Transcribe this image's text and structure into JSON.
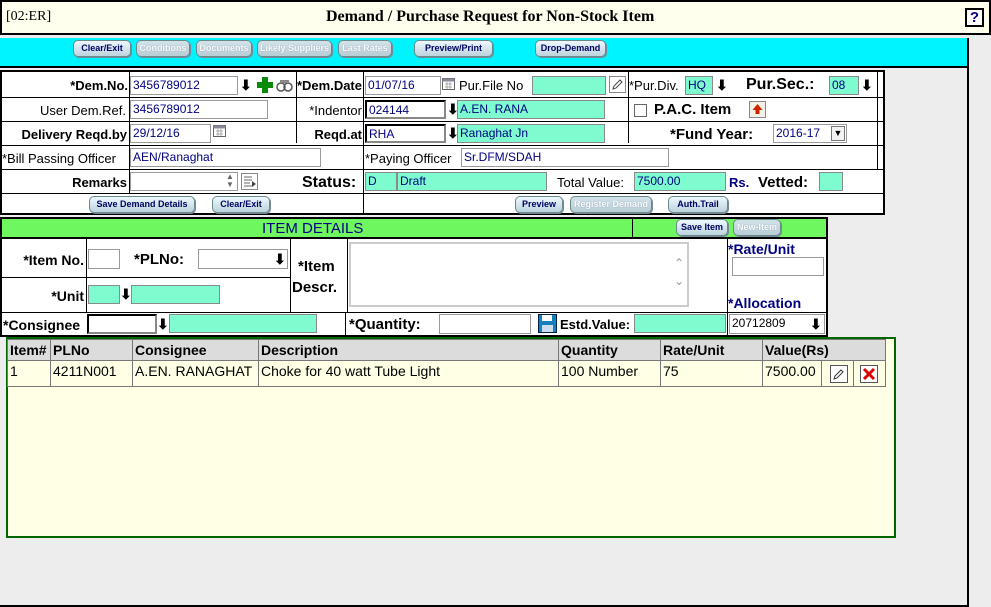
{
  "window": {
    "code": "[02:ER]",
    "title": "Demand / Purchase Request for Non-Stock Item",
    "help": "?"
  },
  "toolbar": {
    "clear_exit": "Clear/Exit",
    "conditions": "Conditions",
    "documents": "Documents",
    "likely_suppliers": "Likely Suppliers",
    "last_rates": "Last Rates",
    "preview_print": "Preview/Print",
    "drop_demand": "Drop-Demand"
  },
  "form": {
    "dem_no_label": "*Dem.No.",
    "dem_no": "3456789012",
    "dem_date_label": "*Dem.Date",
    "dem_date": "01/07/16",
    "pur_file_label": "Pur.File No",
    "pur_file": "",
    "pur_div_label": "*Pur.Div.",
    "pur_div": "HQ",
    "pur_sec_label": "Pur.Sec.:",
    "pur_sec": "08",
    "user_dem_ref_label": "User Dem.Ref.",
    "user_dem_ref": "3456789012",
    "indentor_label": "*Indentor",
    "indentor_code": "024144",
    "indentor_name": "A.EN.       RANA",
    "pac_label": "P.A.C. Item",
    "delivery_label": "Delivery Reqd.by",
    "delivery": "29/12/16",
    "reqd_at_label": "Reqd.at",
    "reqd_at_code": "RHA",
    "reqd_at_name": "Ranaghat Jn",
    "fund_year_label": "*Fund Year:",
    "fund_year": "2016-17",
    "bill_officer_label": "*Bill Passing Officer",
    "bill_officer": "AEN/Ranaghat",
    "paying_officer_label": "*Paying Officer",
    "paying_officer": "Sr.DFM/SDAH",
    "remarks_label": "Remarks",
    "remarks": "",
    "status_label": "Status:",
    "status_code": "D",
    "status_text": "Draft",
    "total_value_label": "Total Value:",
    "total_value": "7500.00",
    "currency": "Rs.",
    "vetted_label": "Vetted:",
    "vetted": "",
    "save_demand": "Save Demand Details",
    "clear_exit": "Clear/Exit",
    "preview": "Preview",
    "register_demand": "Register Demand",
    "auth_trail": "Auth.Trail"
  },
  "item": {
    "header": "ITEM DETAILS",
    "save_item": "Save Item",
    "new_item": "New-Item",
    "item_no_label": "*Item No.",
    "item_no": "",
    "plno_label": "*PLNo:",
    "plno": "",
    "descr_label_1": "*Item",
    "descr_label_2": "Descr.",
    "descr": "",
    "rate_label": "*Rate/Unit",
    "rate": "",
    "unit_label": "*Unit",
    "unit": "",
    "unit_name": "",
    "allocation_label": "*Allocation",
    "allocation": "20712809",
    "consignee_label": "*Consignee",
    "consignee": "",
    "consignee_name": "",
    "quantity_label": "*Quantity:",
    "quantity": "",
    "estd_value_label": "Estd.Value:",
    "estd_value": ""
  },
  "table": {
    "headers": [
      "Item#",
      "PLNo",
      "Consignee",
      "Description",
      "Quantity",
      "Rate/Unit",
      "Value(Rs)"
    ],
    "rows": [
      [
        "1",
        "4211N001",
        "A.EN. RANAGHAT",
        "Choke for 40 watt Tube Light",
        "100 Number",
        "75",
        "7500.00"
      ]
    ]
  }
}
